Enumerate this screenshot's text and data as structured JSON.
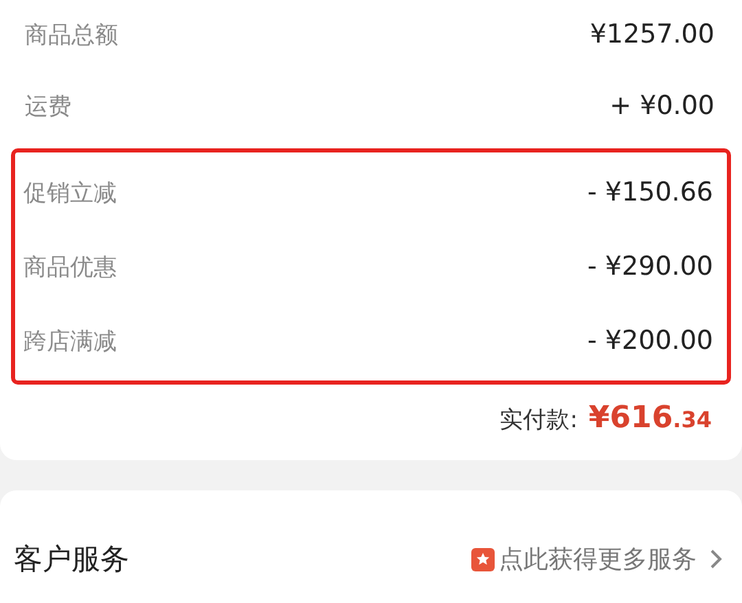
{
  "summary_rows": [
    {
      "label": "商品总额",
      "value": "¥1257.00"
    },
    {
      "label": "运费",
      "value": "+ ¥0.00"
    }
  ],
  "highlight_box": {
    "rows": [
      {
        "label": "促销立减",
        "value": "- ¥150.66"
      },
      {
        "label": "商品优惠",
        "value": "- ¥290.00"
      },
      {
        "label": "跨店满减",
        "value": "- ¥200.00"
      }
    ]
  },
  "total": {
    "label": "实付款:",
    "amount_main": "¥616",
    "amount_fraction": ".34"
  },
  "service": {
    "title": "客户服务",
    "link": "点此获得更多服务"
  }
}
